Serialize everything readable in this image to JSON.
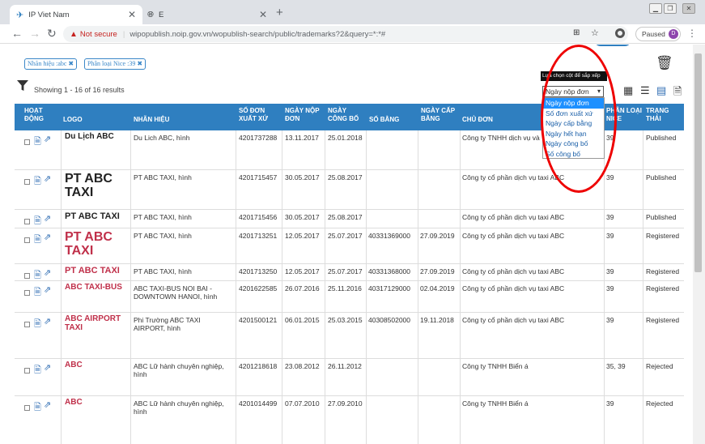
{
  "browser": {
    "tabs": [
      {
        "title": "IP Viet Nam",
        "close": "✕"
      },
      {
        "title": "E",
        "close": "✕"
      }
    ],
    "new_tab": "+",
    "window_controls": [
      "▁",
      "❐",
      "✕"
    ],
    "back": "←",
    "forward": "→",
    "reload": "↻",
    "security": "Not secure",
    "url": "wipopublish.noip.gov.vn/wopublish-search/public/trademarks?2&query=*:*#",
    "paused_label": "Paused",
    "avatar_letter": "D",
    "menu": "⋮"
  },
  "filters": [
    {
      "label": "Nhãn hiệu :abc ✖"
    },
    {
      "label": "Phân loại Nice :39 ✖"
    }
  ],
  "results": {
    "showing": "Showing 1 - 16 of 16 results"
  },
  "sort": {
    "tooltip": "Lựa chọn cột để sắp xếp",
    "selected": "Ngày nộp đơn",
    "options": [
      "Ngày nộp đơn",
      "Số đơn xuất xứ",
      "Ngày cấp bằng",
      "Ngày hết hạn",
      "Ngày công bố",
      "Số công bố"
    ]
  },
  "columns": [
    "HOẠT ĐỘNG",
    "LOGO",
    "NHÃN HIỆU",
    "SỐ ĐƠN XUẤT XỨ",
    "NGÀY NỘP ĐƠN",
    "NGÀY CÔNG BỐ",
    "SỐ BẰNG",
    "NGÀY CẤP BẰNG",
    "CHỦ ĐƠN",
    "PHÂN LOẠI NICE",
    "TRẠNG THÁI"
  ],
  "rows": [
    {
      "logo": "Du Lịch ABC",
      "name": "Du Lich ABC, hình",
      "app_no": "4201737288",
      "filing": "13.11.2017",
      "pub": "25.01.2018",
      "cert": "",
      "grant": "",
      "owner": "Công ty TNHH dịch vụ và",
      "nice": "39",
      "status": "Published"
    },
    {
      "logo": "PT ABC TAXI",
      "name": "PT ABC TAXI, hình",
      "app_no": "4201715457",
      "filing": "30.05.2017",
      "pub": "25.08.2017",
      "cert": "",
      "grant": "",
      "owner": "Công ty cổ phần dịch vụ taxi ABC",
      "nice": "39",
      "status": "Published"
    },
    {
      "logo": "PT ABC TAXI",
      "name": "PT ABC TAXI, hình",
      "app_no": "4201715456",
      "filing": "30.05.2017",
      "pub": "25.08.2017",
      "cert": "",
      "grant": "",
      "owner": "Công ty cổ phần dịch vụ taxi ABC",
      "nice": "39",
      "status": "Published"
    },
    {
      "logo": "PT ABC TAXI",
      "name": "PT ABC TAXI, hình",
      "app_no": "4201713251",
      "filing": "12.05.2017",
      "pub": "25.07.2017",
      "cert": "40331369000",
      "grant": "27.09.2019",
      "owner": "Công ty cổ phần dịch vụ taxi ABC",
      "nice": "39",
      "status": "Registered"
    },
    {
      "logo": "PT ABC TAXI",
      "name": "PT ABC TAXI, hình",
      "app_no": "4201713250",
      "filing": "12.05.2017",
      "pub": "25.07.2017",
      "cert": "40331368000",
      "grant": "27.09.2019",
      "owner": "Công ty cổ phần dịch vụ taxi ABC",
      "nice": "39",
      "status": "Registered"
    },
    {
      "logo": "ABC TAXI-BUS",
      "name": "ABC TAXI-BUS NOI BAI - DOWNTOWN HANOI, hình",
      "app_no": "4201622585",
      "filing": "26.07.2016",
      "pub": "25.11.2016",
      "cert": "40317129000",
      "grant": "02.04.2019",
      "owner": "Công ty cổ phần dịch vụ taxi ABC",
      "nice": "39",
      "status": "Registered"
    },
    {
      "logo": "ABC AIRPORT TAXI",
      "name": "Phi Trường ABC TAXI AIRPORT, hình",
      "app_no": "4201500121",
      "filing": "06.01.2015",
      "pub": "25.03.2015",
      "cert": "40308502000",
      "grant": "19.11.2018",
      "owner": "Công ty cổ phần dịch vụ taxi ABC",
      "nice": "39",
      "status": "Registered"
    },
    {
      "logo": "ABC",
      "name": "ABC Lữ hành chuyên nghiệp, hình",
      "app_no": "4201218618",
      "filing": "23.08.2012",
      "pub": "26.11.2012",
      "cert": "",
      "grant": "",
      "owner": "Công ty TNHH Biển á",
      "nice": "35, 39",
      "status": "Rejected"
    },
    {
      "logo": "ABC",
      "name": "ABC Lữ hành chuyên nghiệp, hình",
      "app_no": "4201014499",
      "filing": "07.07.2010",
      "pub": "27.09.2010",
      "cert": "",
      "grant": "",
      "owner": "Công ty TNHH Biển á",
      "nice": "39",
      "status": "Rejected"
    }
  ],
  "colors": {
    "header_bg": "#2f7fc0",
    "link": "#2f6db3",
    "highlight": "#e00000"
  }
}
